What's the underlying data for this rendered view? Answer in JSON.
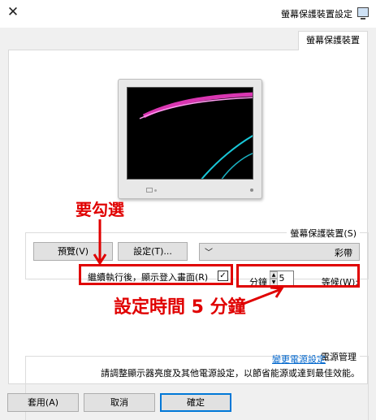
{
  "window": {
    "title": "螢幕保護裝置設定",
    "close_glyph": "✕"
  },
  "tab": {
    "label": "螢幕保護裝置"
  },
  "screensaver_group": {
    "label": "螢幕保護裝置(S)",
    "selected": "彩帶",
    "settings_label": "設定(T)...",
    "preview_label": "預覽(V)",
    "wait_label": "等候(W):",
    "wait_value": "5",
    "minutes_label": "分鐘",
    "resume_checked": true,
    "resume_label": "繼續執行後，顯示登入畫面(R)"
  },
  "annotations": {
    "must_check": "要勾選",
    "set_time": "設定時間 5 分鐘"
  },
  "power_group": {
    "label": "電源管理",
    "description": "請調整顯示器亮度及其他電源設定，以節省能源或達到最佳效能。",
    "link": "變更電源設定"
  },
  "buttons": {
    "ok": "確定",
    "cancel": "取消",
    "apply": "套用(A)"
  }
}
